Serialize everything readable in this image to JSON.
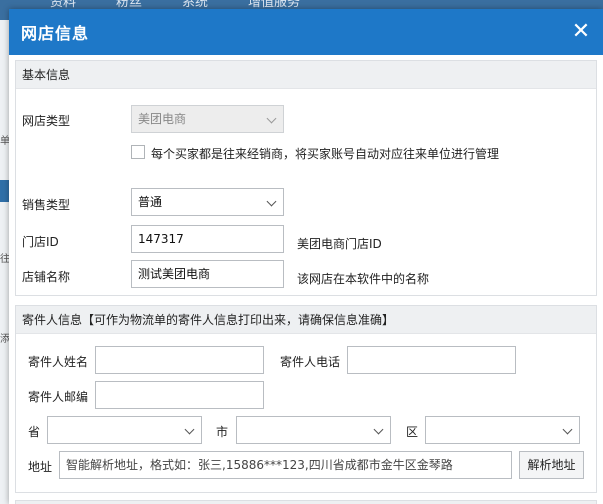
{
  "background": {
    "menu": [
      "资料",
      "粉丝",
      "系统",
      "增值服务"
    ],
    "left_stubs": [
      "单位",
      "往来",
      "添加"
    ]
  },
  "dialog": {
    "title": "网店信息",
    "close_icon": "close-icon"
  },
  "basic": {
    "section_title": "基本信息",
    "shop_type_label": "网店类型",
    "shop_type_value": "美团电商",
    "checkbox_label": "每个买家都是往来经销商，将买家账号自动对应往来单位进行管理",
    "sale_type_label": "销售类型",
    "sale_type_value": "普通",
    "store_id_label": "门店ID",
    "store_id_value": "147317",
    "store_id_hint": "美团电商门店ID",
    "shop_name_label": "店铺名称",
    "shop_name_value": "测试美团电商",
    "shop_name_hint": "该网店在本软件中的名称"
  },
  "sender": {
    "section_title": "寄件人信息【可作为物流单的寄件人信息打印出来，请确保信息准确】",
    "name_label": "寄件人姓名",
    "name_value": "",
    "phone_label": "寄件人电话",
    "phone_value": "",
    "zip_label": "寄件人邮编",
    "zip_value": "",
    "province_label": "省",
    "city_label": "市",
    "district_label": "区",
    "address_label": "地址",
    "address_placeholder": "智能解析地址，格式如：张三,15886***123,四川省成都市金牛区金琴路",
    "parse_button": "解析地址"
  }
}
